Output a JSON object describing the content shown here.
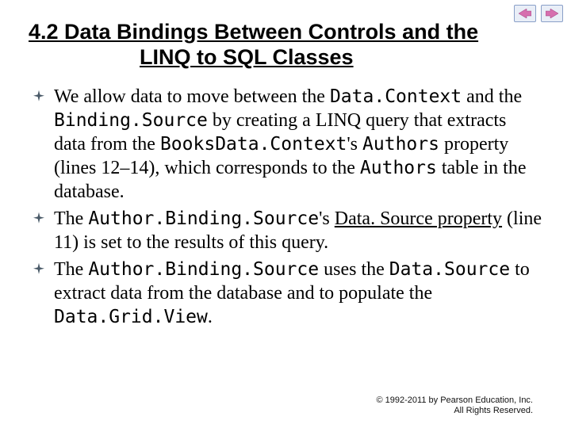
{
  "nav": {
    "prev_icon": "arrow-left-icon",
    "next_icon": "arrow-right-icon"
  },
  "title": {
    "line1": "4.2 Data Bindings Between Controls and the",
    "line2": "LINQ to SQL Classes"
  },
  "bullets": [
    {
      "t1": "We allow data to move between the ",
      "c1": "Data.Context",
      "t2": " and the ",
      "c2": "Binding.Source",
      "t3": " by creating a LINQ query that extracts data from the ",
      "c3": "BooksData.Context",
      "t4": "'s ",
      "c4": "Authors",
      "t5": " property (lines 12–14), which corresponds to the ",
      "c5": "Authors",
      "t6": " table in the database."
    },
    {
      "t1": "The ",
      "c1": "Author.Binding.Source",
      "t2": "'s ",
      "link": "Data. Source property",
      "t3": " (line 11) is set to the results of this query."
    },
    {
      "t1": "The ",
      "c1": "Author.Binding.Source",
      "t2": " uses the ",
      "c2": "Data.Source",
      "t3": " to extract data from the database and to populate the ",
      "c3": "Data.Grid.View",
      "t4": "."
    }
  ],
  "footer": {
    "line1": "© 1992-2011 by Pearson Education, Inc.",
    "line2": "All Rights Reserved."
  }
}
